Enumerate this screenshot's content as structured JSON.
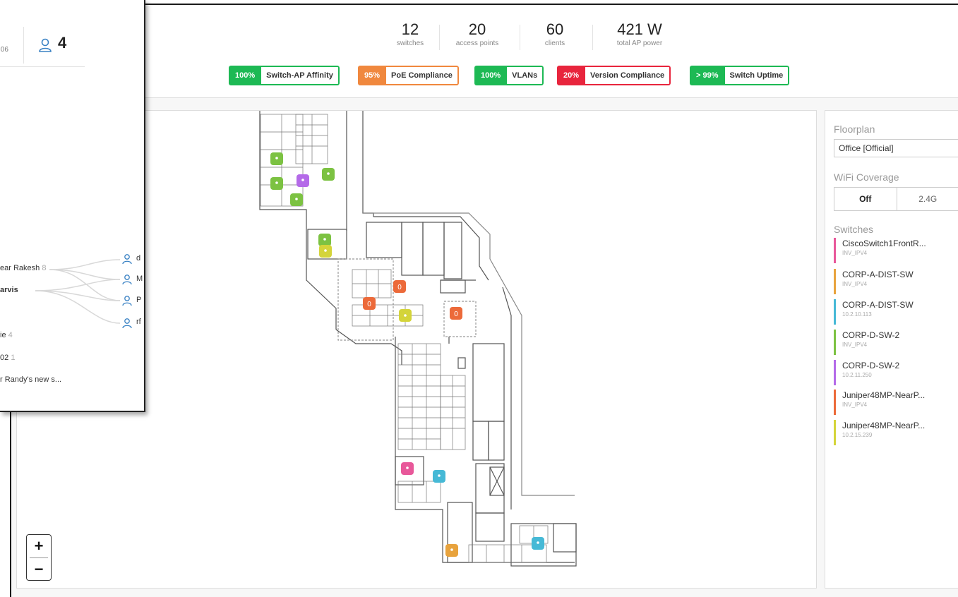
{
  "stats": [
    {
      "value": "12",
      "label": "switches"
    },
    {
      "value": "20",
      "label": "access points"
    },
    {
      "value": "60",
      "label": "clients"
    },
    {
      "value": "421 W",
      "label": "total AP power"
    }
  ],
  "badges": [
    {
      "pct": "100%",
      "label": "Switch-AP Affinity",
      "color": "#1db954"
    },
    {
      "pct": "95%",
      "label": "PoE Compliance",
      "color": "#f0883e"
    },
    {
      "pct": "100%",
      "label": "VLANs",
      "color": "#1db954"
    },
    {
      "pct": "20%",
      "label": "Version Compliance",
      "color": "#e8253d"
    },
    {
      "pct": "> 99%",
      "label": "Switch Uptime",
      "color": "#1db954"
    }
  ],
  "right_panel": {
    "floorplan_title": "Floorplan",
    "floorplan_value": "Office [Official]",
    "wifi_title": "WiFi Coverage",
    "wifi_options": [
      "Off",
      "2.4G"
    ],
    "switches_title": "Switches",
    "switches": [
      {
        "name": "CiscoSwitch1FrontR...",
        "sub": "INV_IPV4",
        "color": "#e8589a"
      },
      {
        "name": "CORP-A-DIST-SW",
        "sub": "INV_IPV4",
        "color": "#e8a33d"
      },
      {
        "name": "CORP-A-DIST-SW",
        "sub": "10.2.10.113",
        "color": "#46b9d6"
      },
      {
        "name": "CORP-D-SW-2",
        "sub": "INV_IPV4",
        "color": "#7cc242"
      },
      {
        "name": "CORP-D-SW-2",
        "sub": "10.2.11.250",
        "color": "#b46ae8"
      },
      {
        "name": "Juniper48MP-NearP...",
        "sub": "INV_IPV4",
        "color": "#ec6a3a"
      },
      {
        "name": "Juniper48MP-NearP...",
        "sub": "10.2.15.239",
        "color": "#d4d43a"
      }
    ]
  },
  "zoom": {
    "in": "+",
    "out": "−"
  },
  "popup": {
    "left_value": ":06",
    "users_count": "4",
    "items": [
      {
        "text": "ear Rakesh",
        "count": "8"
      },
      {
        "text": "arvis",
        "count": ""
      },
      {
        "text": "ie",
        "count": "4"
      },
      {
        "text": "02",
        "count": "1"
      },
      {
        "text": "r Randy's new s...",
        "count": ""
      }
    ],
    "users": [
      "d",
      "M",
      "P",
      "rf"
    ]
  },
  "floor_labels": {
    "ap_zero": "0"
  },
  "colors": {
    "pink": "#e8589a",
    "orange": "#e8a33d",
    "cyan": "#46b9d6",
    "green": "#7cc242",
    "purple": "#b46ae8",
    "red_orange": "#ec6a3a",
    "yellow": "#d4d43a",
    "green_ok": "#1db954"
  }
}
